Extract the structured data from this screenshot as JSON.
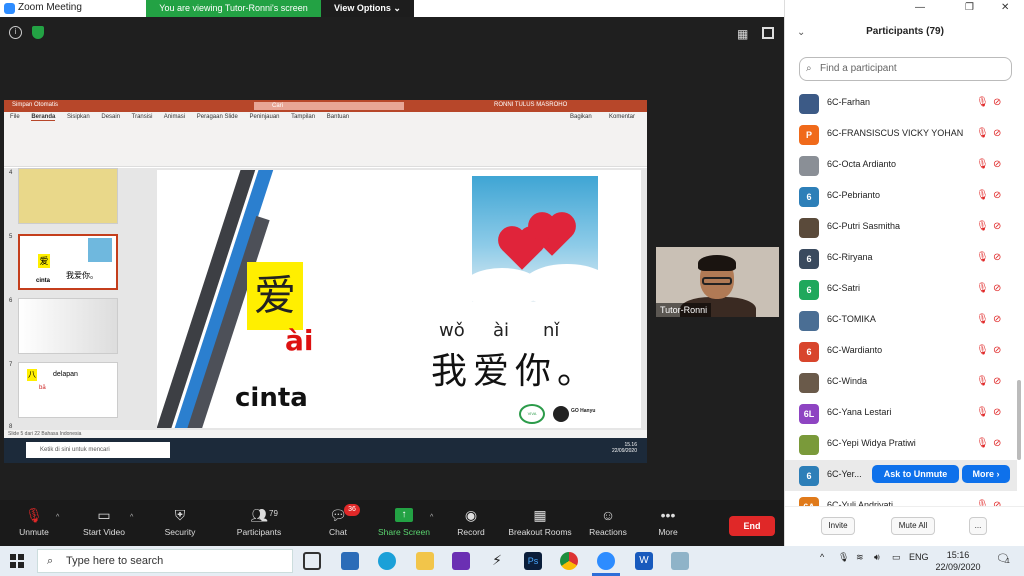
{
  "window": {
    "title": "Zoom Meeting"
  },
  "banner": {
    "viewing": "You are viewing Tutor-Ronni's screen",
    "options": "View Options ⌄"
  },
  "ppt": {
    "autosave": "Simpan Otomatis",
    "search": "Cari",
    "user": "RONNI TULUS MASROHO",
    "tabs": [
      "File",
      "Beranda",
      "Sisipkan",
      "Desain",
      "Transisi",
      "Animasi",
      "Peragaan Slide",
      "Peninjauan",
      "Tampilan",
      "Bantuan"
    ],
    "share": "Bagikan",
    "comment": "Komentar",
    "thumb_numbers": [
      "4",
      "5",
      "6",
      "7",
      "8"
    ],
    "thumb7_title": "delapan",
    "thumb7_pinyin": "bā",
    "status": "Slide 5 dari 22     Bahasa Indonesia",
    "taskbar_search": "Ketik di sini untuk mencari",
    "taskbar_time": "15.16",
    "taskbar_date": "22/09/2020"
  },
  "slide": {
    "big_char": "爱",
    "big_pinyin": "ài",
    "word": "cinta",
    "pinyin": [
      "wǒ",
      "ài",
      "nǐ"
    ],
    "sentence": "我爱你。",
    "logo1": "VIVA",
    "logo2": "GO Hanyu"
  },
  "video": {
    "name": "Tutor-Ronni"
  },
  "participants": {
    "title": "Participants (79)",
    "search_placeholder": "Find a participant",
    "list": [
      {
        "name": "6C-Farhan",
        "avatar": "",
        "color": "#3c5a86"
      },
      {
        "name": "6C-FRANSISCUS VICKY YOHAN",
        "avatar": "P",
        "color": "#f06a1a"
      },
      {
        "name": "6C-Octa Ardianto",
        "avatar": "",
        "color": "#8a8f96"
      },
      {
        "name": "6C-Pebrianto",
        "avatar": "6",
        "color": "#2d7fb8"
      },
      {
        "name": "6C-Putri Sasmitha",
        "avatar": "",
        "color": "#5a4a3a"
      },
      {
        "name": "6C-Riryana",
        "avatar": "6",
        "color": "#3a4a5e"
      },
      {
        "name": "6C-Satri",
        "avatar": "6",
        "color": "#1fa85c"
      },
      {
        "name": "6C-TOMIKA",
        "avatar": "",
        "color": "#4a6e94"
      },
      {
        "name": "6C-Wardianto",
        "avatar": "6",
        "color": "#d8452c"
      },
      {
        "name": "6C-Winda",
        "avatar": "",
        "color": "#6a5a4a"
      },
      {
        "name": "6C-Yana Lestari",
        "avatar": "6L",
        "color": "#8e44c2"
      },
      {
        "name": "6C-Yepi Widya Pratiwi",
        "avatar": "",
        "color": "#7a9a3a"
      },
      {
        "name": "6C-Yer...",
        "avatar": "6",
        "color": "#2d7fb8"
      },
      {
        "name": "6C-Yuli Andriyati",
        "avatar": "6A",
        "color": "#e07a1a"
      }
    ],
    "ask_unmute": "Ask to Unmute",
    "more": "More ›",
    "footer": {
      "invite": "Invite",
      "mute_all": "Mute All",
      "dots": "..."
    }
  },
  "toolbar": {
    "unmute": "Unmute",
    "start_video": "Start Video",
    "security": "Security",
    "participants": "Participants",
    "participants_count": "79",
    "chat": "Chat",
    "chat_badge": "36",
    "share_screen": "Share Screen",
    "record": "Record",
    "breakout": "Breakout Rooms",
    "reactions": "Reactions",
    "more": "More",
    "end": "End"
  },
  "taskbar": {
    "search": "Type here to search",
    "lang": "ENG",
    "time": "15:16",
    "date": "22/09/2020",
    "notif": "1"
  }
}
